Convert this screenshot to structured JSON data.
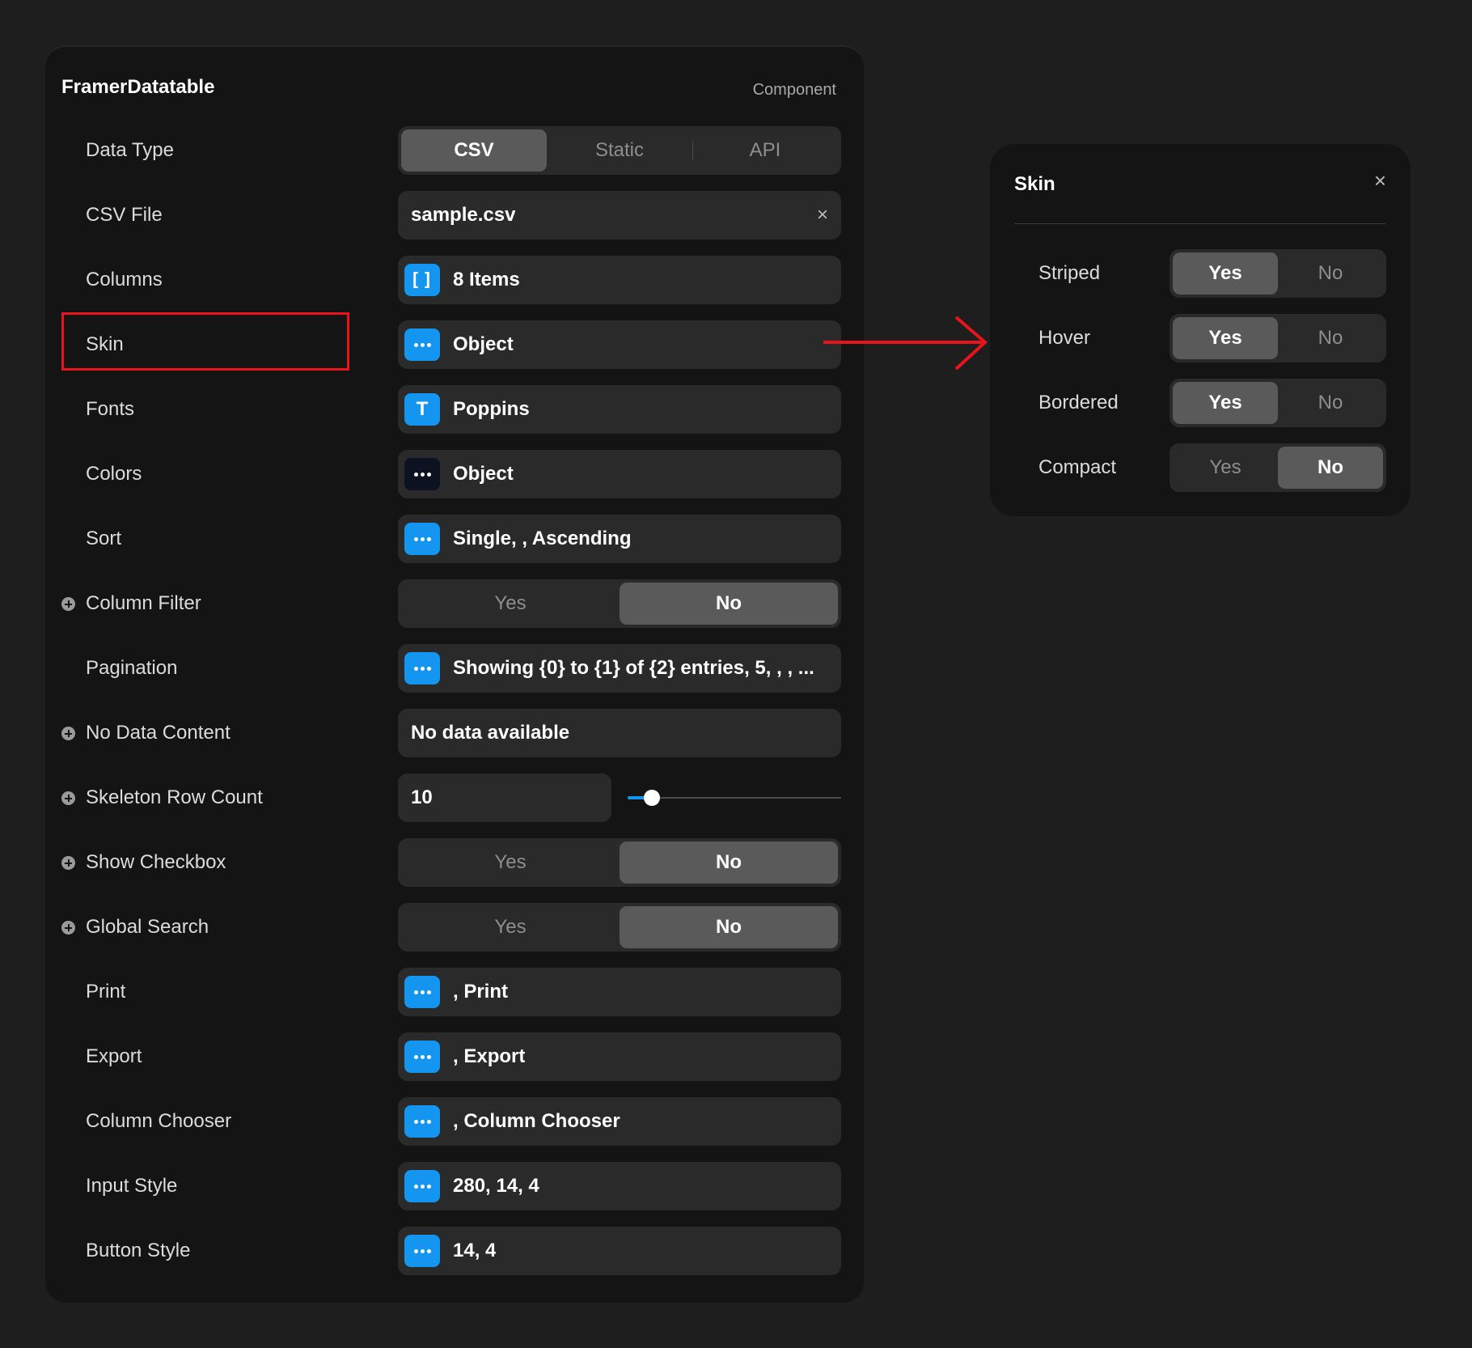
{
  "panel": {
    "title": "FramerDatatable",
    "kind": "Component",
    "rows": [
      {
        "label": "Data Type",
        "control": "segmented",
        "options": [
          "CSV",
          "Static",
          "API"
        ],
        "selected": "CSV"
      },
      {
        "label": "CSV File",
        "control": "file",
        "value": "sample.csv",
        "clear_icon": "×"
      },
      {
        "label": "Columns",
        "control": "badge",
        "icon": "brackets-icon",
        "value": "8 Items"
      },
      {
        "label": "Skin",
        "control": "badge",
        "icon": "more-dots-icon",
        "value": "Object"
      },
      {
        "label": "Fonts",
        "control": "badge",
        "icon": "text-t-icon",
        "value": "Poppins"
      },
      {
        "label": "Colors",
        "control": "badge",
        "icon": "more-dots-icon",
        "value": "Object"
      },
      {
        "label": "Sort",
        "control": "badge",
        "icon": "more-dots-icon",
        "value": "Single, , Ascending"
      },
      {
        "label": "Column Filter",
        "control": "yesno",
        "options": [
          "Yes",
          "No"
        ],
        "selected": "No"
      },
      {
        "label": "Pagination",
        "control": "badge",
        "icon": "more-dots-icon",
        "value": "Showing {0} to {1} of {2} entries, 5, , , ..."
      },
      {
        "label": "No Data Content",
        "control": "text",
        "value": "No data available"
      },
      {
        "label": "Skeleton Row Count",
        "control": "slider",
        "value": "10",
        "slider_fraction": 0.115
      },
      {
        "label": "Show Checkbox",
        "control": "yesno",
        "options": [
          "Yes",
          "No"
        ],
        "selected": "No"
      },
      {
        "label": "Global Search",
        "control": "yesno",
        "options": [
          "Yes",
          "No"
        ],
        "selected": "No"
      },
      {
        "label": "Print",
        "control": "badge",
        "icon": "more-dots-icon",
        "value": ", Print"
      },
      {
        "label": "Export",
        "control": "badge",
        "icon": "more-dots-icon",
        "value": ", Export"
      },
      {
        "label": "Column Chooser",
        "control": "badge",
        "icon": "more-dots-icon",
        "value": ", Column Chooser"
      },
      {
        "label": "Input Style",
        "control": "badge",
        "icon": "more-dots-icon",
        "value": "280, 14, 4"
      },
      {
        "label": "Button Style",
        "control": "badge",
        "icon": "more-dots-icon",
        "value": "14, 4"
      }
    ]
  },
  "skin_popup": {
    "title": "Skin",
    "close_icon": "×",
    "rows": [
      {
        "label": "Striped",
        "options": [
          "Yes",
          "No"
        ],
        "selected": "Yes"
      },
      {
        "label": "Hover",
        "options": [
          "Yes",
          "No"
        ],
        "selected": "Yes"
      },
      {
        "label": "Bordered",
        "options": [
          "Yes",
          "No"
        ],
        "selected": "Yes"
      },
      {
        "label": "Compact",
        "options": [
          "Yes",
          "No"
        ],
        "selected": "No"
      }
    ]
  },
  "colors": {
    "accent": "#1496f0",
    "annotation": "#e8141c",
    "colors_badge": "#0c1220"
  }
}
